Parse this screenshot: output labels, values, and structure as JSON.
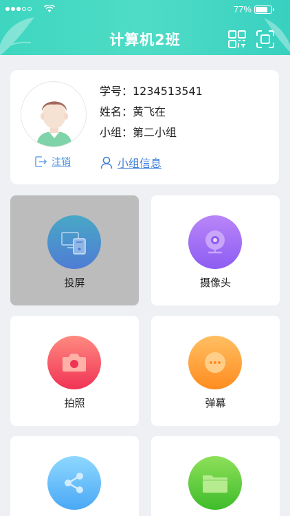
{
  "status_bar": {
    "battery": "77%"
  },
  "header": {
    "title": "计算机2班"
  },
  "profile": {
    "student_id": "学号：1234513541",
    "name": "姓名：黄飞在",
    "group": "小组：第二小组",
    "logout_label": "注销",
    "group_info_label": "小组信息"
  },
  "tiles": [
    {
      "label": "投屏",
      "icon": "screen-cast-icon",
      "color": "#4f7cd4"
    },
    {
      "label": "摄像头",
      "icon": "camera-icon",
      "color": "#8d5df2"
    },
    {
      "label": "拍照",
      "icon": "photo-camera-icon",
      "color": "#f03355"
    },
    {
      "label": "弹幕",
      "icon": "chat-bubble-icon",
      "color": "#ff8c1f"
    },
    {
      "label": "",
      "icon": "share-icon",
      "color": "#4aa8f5"
    },
    {
      "label": "",
      "icon": "folder-icon",
      "color": "#3ebc2a"
    }
  ]
}
